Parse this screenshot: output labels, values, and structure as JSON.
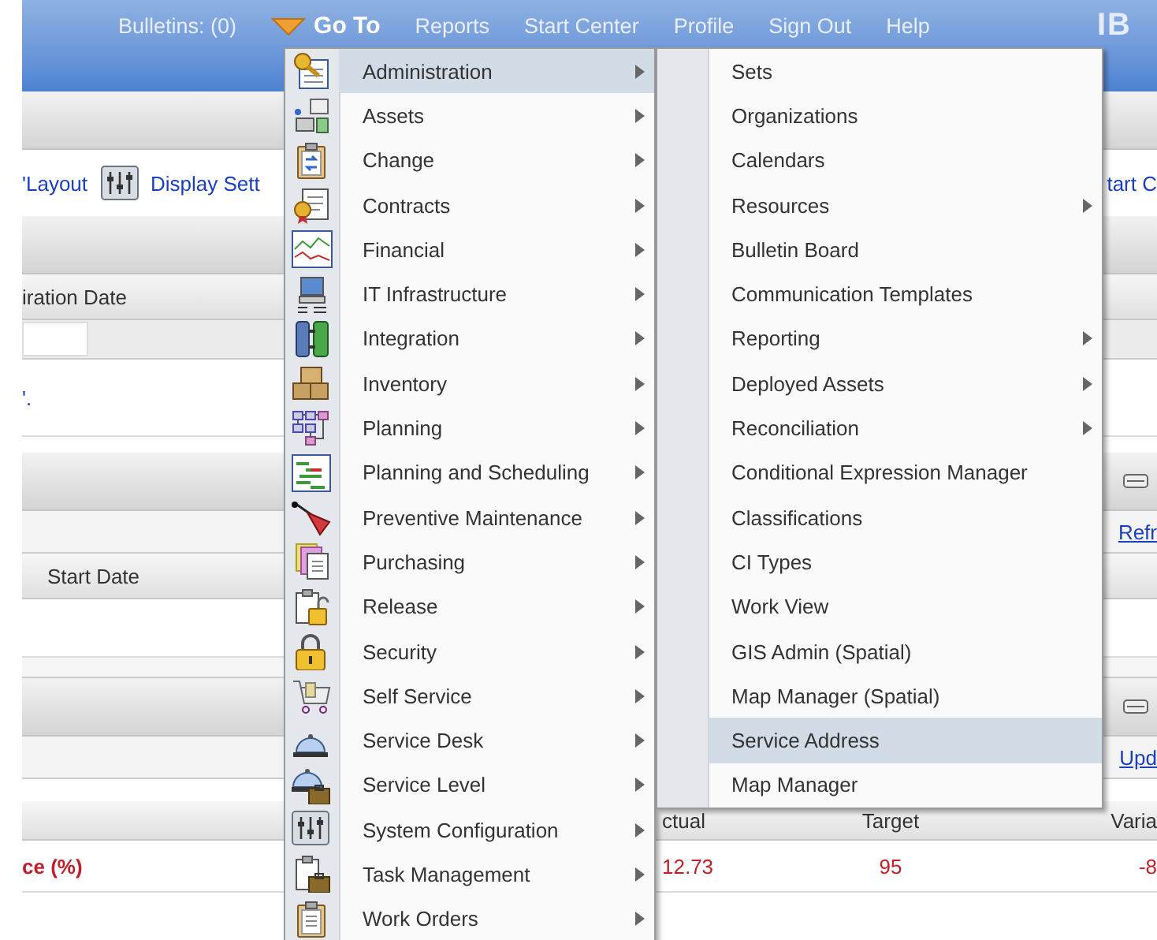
{
  "nav": [
    {
      "label": "Bulletins: (0)",
      "kind": "link"
    },
    {
      "label": "Go To",
      "kind": "menu"
    },
    {
      "label": "Reports",
      "kind": "link"
    },
    {
      "label": "Start Center",
      "kind": "link"
    },
    {
      "label": "Profile",
      "kind": "link"
    },
    {
      "label": "Sign Out",
      "kind": "link"
    },
    {
      "label": "Help",
      "kind": "link"
    }
  ],
  "logo": "IB",
  "toolbar": {
    "links": [
      {
        "label": "'Layout",
        "icon": false
      },
      {
        "label": "Display Sett",
        "icon": true
      }
    ],
    "right_link": "tart C"
  },
  "portlet_1": {
    "column": "iration Date",
    "message": "'."
  },
  "portlet_2": {
    "action_link": "Refr",
    "column": "Start Date"
  },
  "portlet_3": {
    "action_link": "Upd",
    "columns": [
      "ctual",
      "Target",
      "Varia"
    ],
    "row": [
      "ce (%)",
      "12.73",
      "95",
      "-8"
    ]
  },
  "menu": {
    "items": [
      {
        "label": "Administration",
        "selected": true
      },
      {
        "label": "Assets",
        "selected": false
      },
      {
        "label": "Change",
        "selected": false
      },
      {
        "label": "Contracts",
        "selected": false
      },
      {
        "label": "Financial",
        "selected": false
      },
      {
        "label": "IT Infrastructure",
        "selected": false
      },
      {
        "label": "Integration",
        "selected": false
      },
      {
        "label": "Inventory",
        "selected": false
      },
      {
        "label": "Planning",
        "selected": false
      },
      {
        "label": "Planning and Scheduling",
        "selected": false
      },
      {
        "label": "Preventive Maintenance",
        "selected": false
      },
      {
        "label": "Purchasing",
        "selected": false
      },
      {
        "label": "Release",
        "selected": false
      },
      {
        "label": "Security",
        "selected": false
      },
      {
        "label": "Self Service",
        "selected": false
      },
      {
        "label": "Service Desk",
        "selected": false
      },
      {
        "label": "Service Level",
        "selected": false
      },
      {
        "label": "System Configuration",
        "selected": false
      },
      {
        "label": "Task Management",
        "selected": false
      },
      {
        "label": "Work Orders",
        "selected": false
      }
    ]
  },
  "submenu": {
    "items": [
      {
        "label": "Sets",
        "selected": false,
        "submenu": false
      },
      {
        "label": "Organizations",
        "selected": false,
        "submenu": false
      },
      {
        "label": "Calendars",
        "selected": false,
        "submenu": false
      },
      {
        "label": "Resources",
        "selected": false,
        "submenu": true
      },
      {
        "label": "Bulletin Board",
        "selected": false,
        "submenu": false
      },
      {
        "label": "Communication Templates",
        "selected": false,
        "submenu": false
      },
      {
        "label": "Reporting",
        "selected": false,
        "submenu": true
      },
      {
        "label": "Deployed Assets",
        "selected": false,
        "submenu": true
      },
      {
        "label": "Reconciliation",
        "selected": false,
        "submenu": true
      },
      {
        "label": "Conditional Expression Manager",
        "selected": false,
        "submenu": false
      },
      {
        "label": "Classifications",
        "selected": false,
        "submenu": false
      },
      {
        "label": "CI Types",
        "selected": false,
        "submenu": false
      },
      {
        "label": "Work View",
        "selected": false,
        "submenu": false
      },
      {
        "label": "GIS Admin (Spatial)",
        "selected": false,
        "submenu": false
      },
      {
        "label": "Map Manager (Spatial)",
        "selected": false,
        "submenu": false
      },
      {
        "label": "Service Address",
        "selected": true,
        "submenu": false
      },
      {
        "label": "Map Manager",
        "selected": false,
        "submenu": false
      }
    ]
  }
}
